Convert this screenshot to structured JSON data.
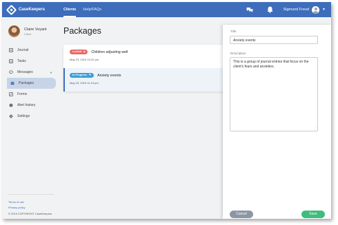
{
  "app": {
    "name": "CaseKeepers"
  },
  "nav": {
    "links": [
      "Clients",
      "Help/FAQs"
    ]
  },
  "user": {
    "name": "Sigmund Freud"
  },
  "profile": {
    "name": "Claire Voyant",
    "role": "Client"
  },
  "sidebar": {
    "items": [
      {
        "label": "Journal",
        "icon": "book-icon"
      },
      {
        "label": "Tasks",
        "icon": "checklist-icon"
      },
      {
        "label": "Messages",
        "icon": "chat-icon"
      },
      {
        "label": "Packages",
        "icon": "package-icon",
        "active": true
      },
      {
        "label": "Forms",
        "icon": "form-icon"
      },
      {
        "label": "Alert history",
        "icon": "alert-icon"
      },
      {
        "label": "Settings",
        "icon": "gear-icon"
      }
    ],
    "footer": {
      "terms": "Terms of use",
      "privacy": "Privacy policy",
      "copyright": "© 2019 COPYRIGHT CaseKeepers"
    }
  },
  "main": {
    "title": "Packages",
    "packages": [
      {
        "status": "Locked",
        "title": "Children adjusting well",
        "date": "May 23, 2019 10:22 pm"
      },
      {
        "status": "In Progress",
        "title": "Anxiety events",
        "date": "May 23, 2019 11:19 pm"
      }
    ]
  },
  "panel": {
    "title_label": "Title",
    "title_value": "Anxiety events",
    "description_label": "Description",
    "description_value": "This is a group of journal entries that focus on the client's fears and anxieties.",
    "cancel_label": "Cancel",
    "save_label": "Save"
  },
  "colors": {
    "brand": "#3d6dbb",
    "locked": "#e86a6a",
    "in_progress": "#3aa0d8",
    "save": "#3ebd7c",
    "cancel": "#8b96a5"
  }
}
